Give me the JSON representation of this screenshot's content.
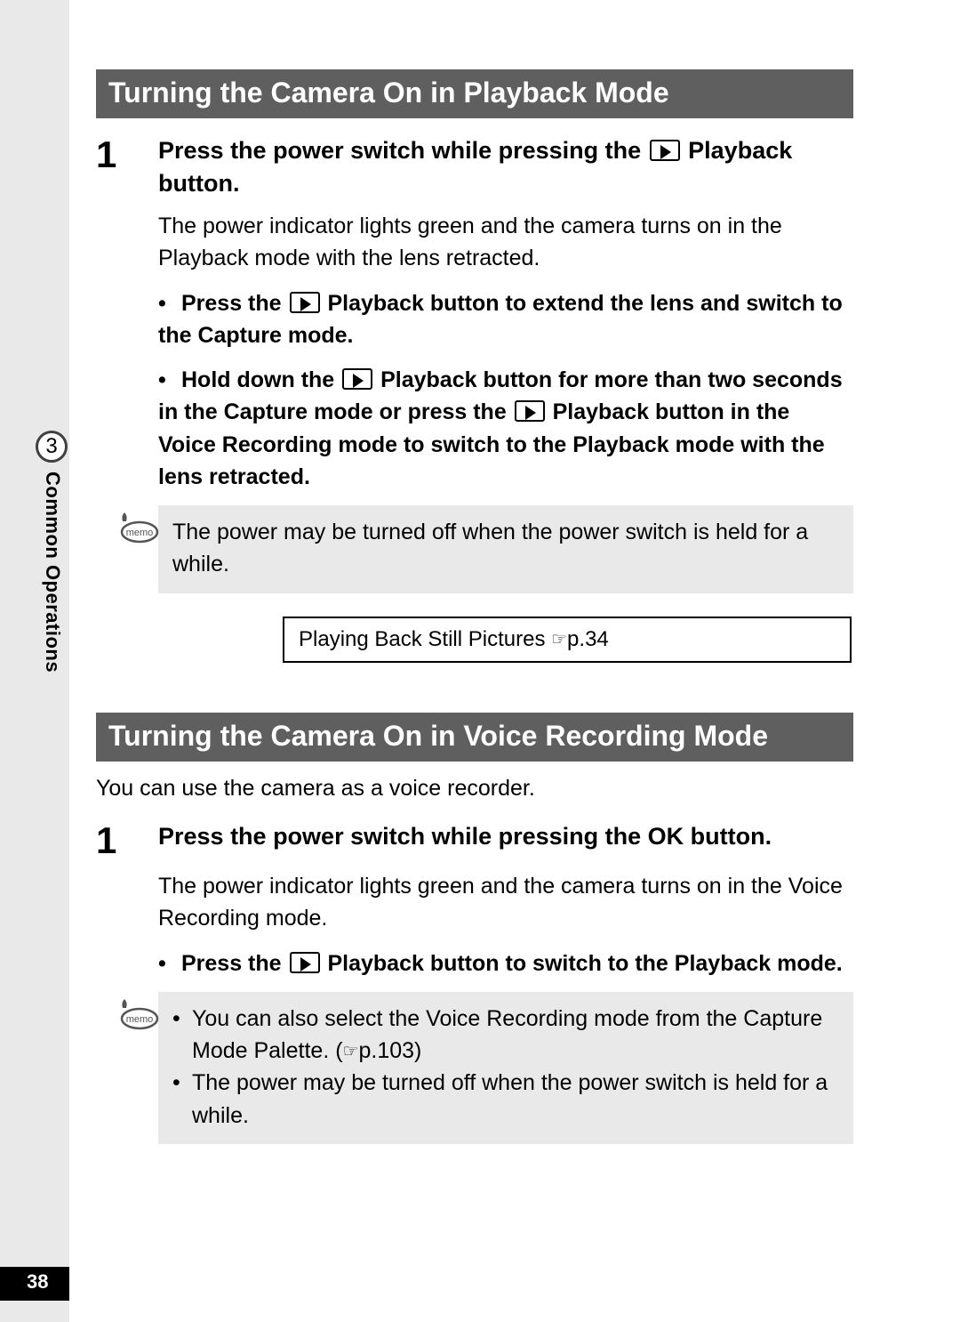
{
  "side": {
    "chapter_number": "3",
    "chapter_label": "Common Operations"
  },
  "page_number": "38",
  "section1": {
    "heading": "Turning the Camera On in Playback Mode",
    "step_number": "1",
    "step_title_pre": "Press the power switch while pressing the ",
    "step_title_post": " Playback button.",
    "body": "The power indicator lights green and the camera turns on in the Playback mode with the lens retracted.",
    "bullet1_pre": "Press the ",
    "bullet1_post": " Playback button to extend the lens and switch to the Capture mode.",
    "bullet2_pre": "Hold down the ",
    "bullet2_mid": " Playback button for more than two seconds in the Capture mode or press the ",
    "bullet2_post": " Playback button in the Voice Recording mode to switch to the Playback mode with the lens retracted.",
    "memo": "The power may be turned off when the power switch is held for a while.",
    "ref_text": "Playing Back Still Pictures ",
    "ref_page": "p.34"
  },
  "section2": {
    "heading": "Turning the Camera On in Voice Recording Mode",
    "intro": "You can use the camera as a voice recorder.",
    "step_number": "1",
    "step_title": "Press the power switch while pressing the OK button.",
    "body": "The power indicator lights green and the camera turns on in the Voice Recording mode.",
    "bullet1_pre": "Press the ",
    "bullet1_post": " Playback button to switch to the Playback mode.",
    "memo1_pre": "You can also select the Voice Recording mode from the Capture Mode Palette. (",
    "memo1_page": "p.103",
    "memo1_post": ")",
    "memo2": "The power may be turned off when the power switch is held for a while."
  }
}
